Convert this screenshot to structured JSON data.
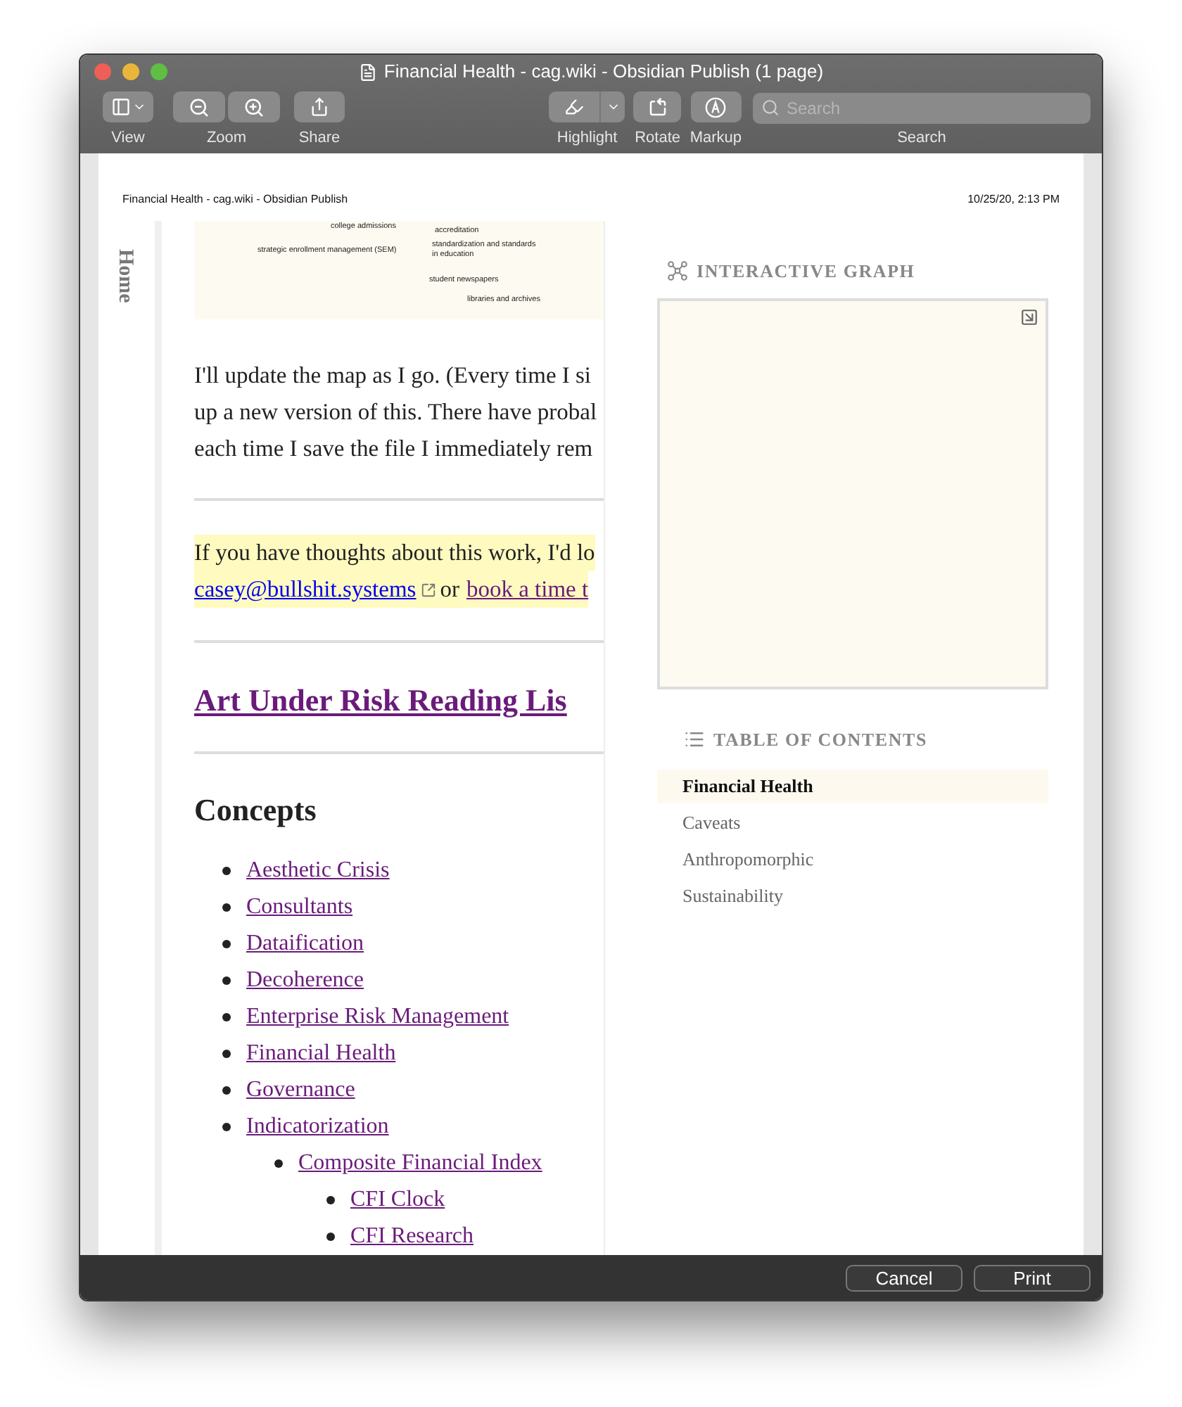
{
  "window": {
    "title": "Financial Health - cag.wiki - Obsidian Publish (1 page)"
  },
  "toolbar": [
    {
      "kind": "view",
      "label": "View"
    },
    {
      "kind": "zoom",
      "label": "Zoom"
    },
    {
      "kind": "share",
      "label": "Share"
    },
    {
      "kind": "highlight",
      "label": "Highlight"
    },
    {
      "kind": "rotate",
      "label": "Rotate"
    },
    {
      "kind": "markup",
      "label": "Markup"
    },
    {
      "kind": "search",
      "label": "Search",
      "placeholder": "Search"
    }
  ],
  "print_header": {
    "title": "Financial Health - cag.wiki - Obsidian Publish",
    "date": "10/25/20, 2:13 PM"
  },
  "page": {
    "home_tab": "Home",
    "map_labels": [
      "college admissions",
      "accreditation",
      "strategic enrollment management (SEM)",
      "standardization and standards\nin education",
      "student newspapers",
      "libraries and archives"
    ],
    "paragraph_lines": [
      "I'll update the map as I go. (Every time I si",
      "up a new version of this. There have probal",
      "each time I save the file I immediately rem"
    ],
    "highlight": {
      "line": "If you have thoughts about this work, I'd lo",
      "email": "casey@bullshit.systems",
      "joiner": "or",
      "booking_link": "book a time t"
    },
    "reading_list_link": "Art Under Risk Reading Lis",
    "concepts_heading": "Concepts",
    "concepts": [
      {
        "label": "Aesthetic Crisis"
      },
      {
        "label": "Consultants"
      },
      {
        "label": "Dataification"
      },
      {
        "label": "Decoherence"
      },
      {
        "label": "Enterprise Risk Management"
      },
      {
        "label": "Financial Health"
      },
      {
        "label": "Governance"
      },
      {
        "label": "Indicatorization",
        "children": [
          {
            "label": "Composite Financial Index",
            "children": [
              {
                "label": "CFI Clock"
              },
              {
                "label": "CFI Research"
              }
            ]
          }
        ]
      }
    ]
  },
  "sidebar": {
    "graph_title": "INTERACTIVE GRAPH",
    "toc_title": "TABLE OF CONTENTS",
    "toc_items": [
      {
        "label": "Financial Health",
        "selected": true
      },
      {
        "label": "Caveats",
        "selected": false
      },
      {
        "label": "Anthropomorphic",
        "selected": false
      },
      {
        "label": "Sustainability",
        "selected": false
      }
    ]
  },
  "footer_buttons": [
    "Cancel",
    "Print"
  ]
}
